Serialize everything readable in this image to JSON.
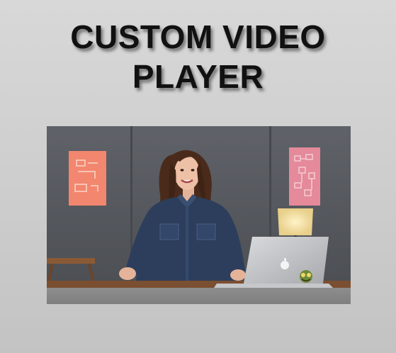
{
  "page": {
    "title_line1": "CUSTOM VIDEO",
    "title_line2": "PLAYER"
  },
  "player": {
    "controls_bar_state": "hidden"
  },
  "colors": {
    "background": "#cfcfcf",
    "title": "#111111",
    "wall": "#5b5e63",
    "poster_left": "#f2866e",
    "poster_right": "#e48a9a",
    "controls_bar": "#868686"
  }
}
